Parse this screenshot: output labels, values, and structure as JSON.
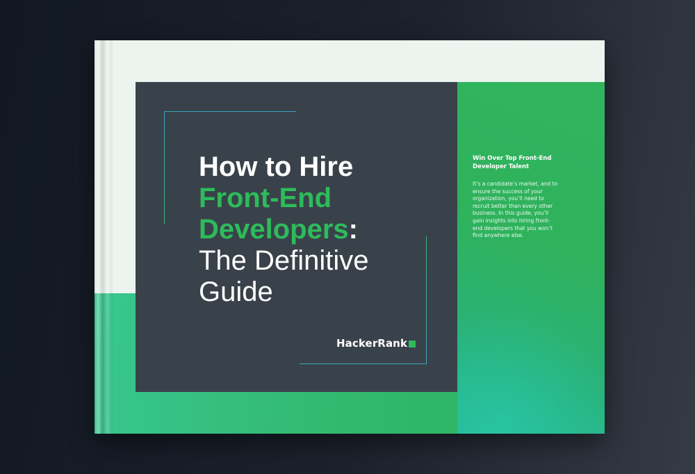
{
  "cover": {
    "title_line1": "How to Hire",
    "title_line2": "Front-End",
    "title_line3": "Developers",
    "title_colon": ":",
    "title_line4": "The Definitive",
    "title_line5": "Guide",
    "logo_text": "HackerRank",
    "side_heading": "Win Over Top Front-End Developer Talent",
    "side_body": "It’s a candidate’s market, and to ensure the success of your organization, you’ll need to recruit better than every other business. In this guide, you’ll gain insights into hiring front-end developers that you won’t find anywhere else."
  },
  "colors": {
    "brand_green": "#2ebb5b",
    "panel_dark": "#39424a",
    "accent_blue": "#3aa6c0"
  }
}
